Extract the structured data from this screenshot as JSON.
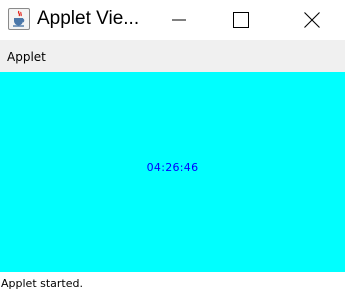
{
  "window": {
    "title": "Applet Vie...",
    "icon": "java-cup-icon",
    "controls": {
      "minimize": "minimize-icon",
      "maximize": "maximize-icon",
      "close": "close-icon"
    }
  },
  "menubar": {
    "items": [
      {
        "label": "Applet"
      }
    ]
  },
  "applet": {
    "clock_text": "04:26:46",
    "background_color": "#00ffff",
    "text_color": "#0000ff"
  },
  "status": {
    "text": "Applet started."
  }
}
